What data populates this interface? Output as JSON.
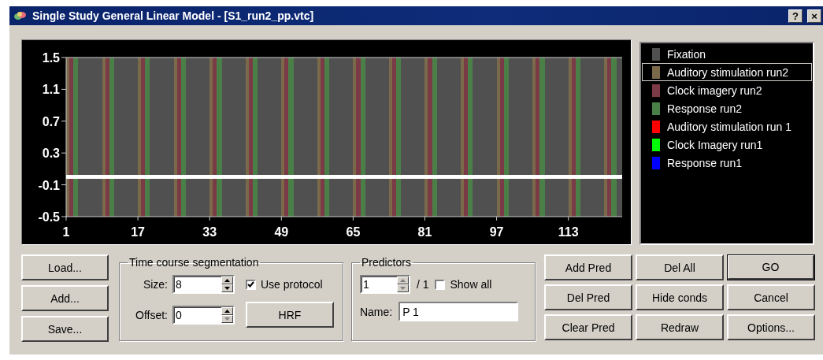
{
  "window": {
    "title": "Single Study General Linear Model - [S1_run2_pp.vtc]",
    "help_button": "?",
    "close_button": "×"
  },
  "chart": {
    "chart_data": {
      "type": "line",
      "x": [
        1,
        125
      ],
      "series": [
        {
          "color": "#ffffff",
          "values": [
            0,
            0
          ]
        }
      ],
      "xlim": [
        1,
        125
      ],
      "ylim": [
        -0.5,
        1.5
      ],
      "xticks": [
        1,
        17,
        33,
        49,
        65,
        81,
        97,
        113
      ],
      "yticks": [
        {
          "value": 1.5,
          "label": "1.5"
        },
        {
          "value": 1.1,
          "label": "1.1"
        },
        {
          "value": 0.7,
          "label": "0.7"
        },
        {
          "value": 0.3,
          "label": "0.3"
        },
        {
          "value": -0.1,
          "label": "-0.1"
        },
        {
          "value": -0.5,
          "label": "-0.5"
        }
      ]
    }
  },
  "conditions": [
    {
      "name": "Fixation",
      "color": "#505050",
      "selected": false
    },
    {
      "name": "Auditory stimulation run2",
      "color": "#7a6a4a",
      "selected": true
    },
    {
      "name": "Clock imagery run2",
      "color": "#7a3a46",
      "selected": false
    },
    {
      "name": "Response run2",
      "color": "#4a8048",
      "selected": false
    },
    {
      "name": "Auditory stimulation run 1",
      "color": "#ff0000",
      "selected": false
    },
    {
      "name": "Clock Imagery run1",
      "color": "#00ff00",
      "selected": false
    },
    {
      "name": "Response run1",
      "color": "#0000ff",
      "selected": false
    }
  ],
  "file_buttons": [
    "Load...",
    "Add...",
    "Save..."
  ],
  "segmentation": {
    "title": "Time course segmentation",
    "size": {
      "label": "Size:",
      "value": "8",
      "up_disabled": false,
      "down_disabled": false
    },
    "offset": {
      "label": "Offset:",
      "value": "0",
      "up_disabled": false,
      "down_disabled": true
    },
    "use_protocol": {
      "label": "Use protocol",
      "checked": true
    },
    "hrf_button": "HRF"
  },
  "predictors": {
    "title": "Predictors",
    "index": {
      "value": "1",
      "up_disabled": true,
      "down_disabled": true
    },
    "count": "/ 1",
    "show_all": {
      "label": "Show all",
      "checked": false
    },
    "name": {
      "label": "Name:",
      "value": "P 1"
    }
  },
  "action_buttons": [
    {
      "label": "Add Pred",
      "default": false
    },
    {
      "label": "Del All",
      "default": false
    },
    {
      "label": "GO",
      "default": true
    },
    {
      "label": "Del Pred",
      "default": false
    },
    {
      "label": "Hide conds",
      "default": false
    },
    {
      "label": "Cancel",
      "default": false
    },
    {
      "label": "Clear Pred",
      "default": false
    },
    {
      "label": "Redraw",
      "default": false
    },
    {
      "label": "Options...",
      "default": false
    }
  ]
}
